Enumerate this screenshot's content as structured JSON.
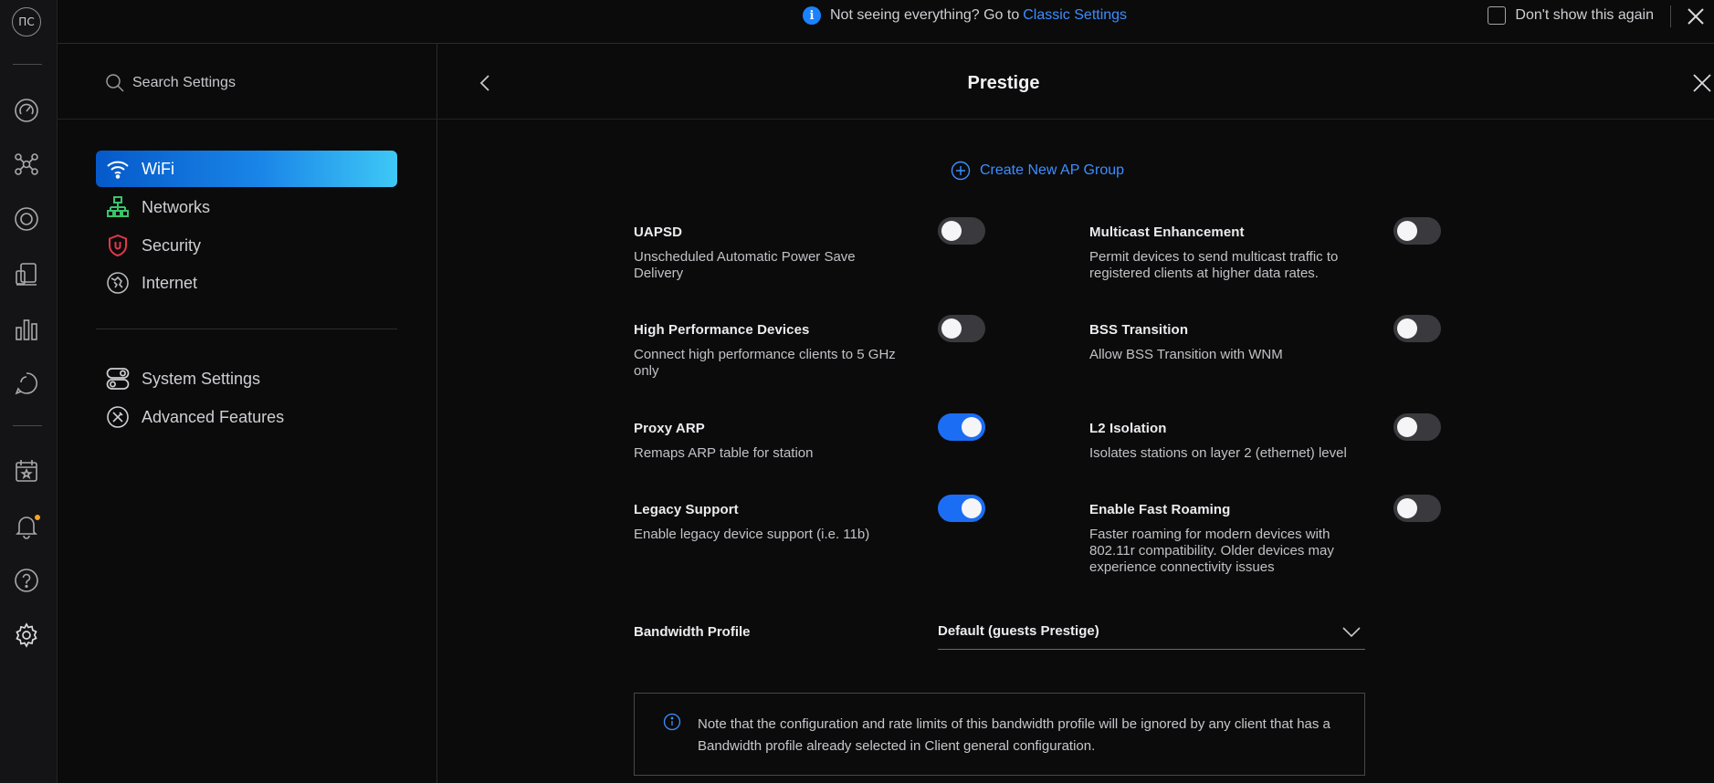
{
  "rail": {
    "avatar_initials": "ПС",
    "icons": [
      "dashboard-icon",
      "topology-icon",
      "devices-icon",
      "clients-icon",
      "statistics-icon",
      "insights-icon",
      "events-icon",
      "notifications-icon",
      "help-icon",
      "settings-icon"
    ]
  },
  "banner": {
    "message": "Not seeing everything? Go to",
    "link_text": "Classic Settings",
    "dont_show_label": "Don't show this again"
  },
  "sidebar": {
    "search_placeholder": "Search Settings",
    "items": [
      {
        "label": "WiFi",
        "active": true
      },
      {
        "label": "Networks"
      },
      {
        "label": "Security"
      },
      {
        "label": "Internet"
      },
      {
        "label": "System Settings"
      },
      {
        "label": "Advanced Features"
      }
    ]
  },
  "panel": {
    "title": "Prestige",
    "create_group_label": "Create New AP Group",
    "settings": [
      {
        "name": "UAPSD",
        "desc": "Unscheduled Automatic Power Save Delivery",
        "on": false
      },
      {
        "name": "Multicast Enhancement",
        "desc": "Permit devices to send multicast traffic to registered clients at higher data rates.",
        "on": false
      },
      {
        "name": "High Performance Devices",
        "desc": "Connect high performance clients to 5 GHz only",
        "on": false
      },
      {
        "name": "BSS Transition",
        "desc": "Allow BSS Transition with WNM",
        "on": false
      },
      {
        "name": "Proxy ARP",
        "desc": "Remaps ARP table for station",
        "on": true
      },
      {
        "name": "L2 Isolation",
        "desc": "Isolates stations on layer 2 (ethernet) level",
        "on": false
      },
      {
        "name": "Legacy Support",
        "desc": "Enable legacy device support (i.e. 11b)",
        "on": true
      },
      {
        "name": "Enable Fast Roaming",
        "desc": "Faster roaming for modern devices with 802.11r compatibility. Older devices may experience connectivity issues",
        "on": false
      }
    ],
    "bandwidth_label": "Bandwidth Profile",
    "bandwidth_value": "Default (guests Prestige)",
    "note_text": "Note that the configuration and rate limits of this bandwidth profile will be ignored by any client that has a Bandwidth profile already selected in Client general configuration."
  },
  "colors": {
    "accent": "#1b6ef3",
    "link": "#3d8eff",
    "notification_dot": "#f5a524",
    "background": "#0b0b0c"
  }
}
